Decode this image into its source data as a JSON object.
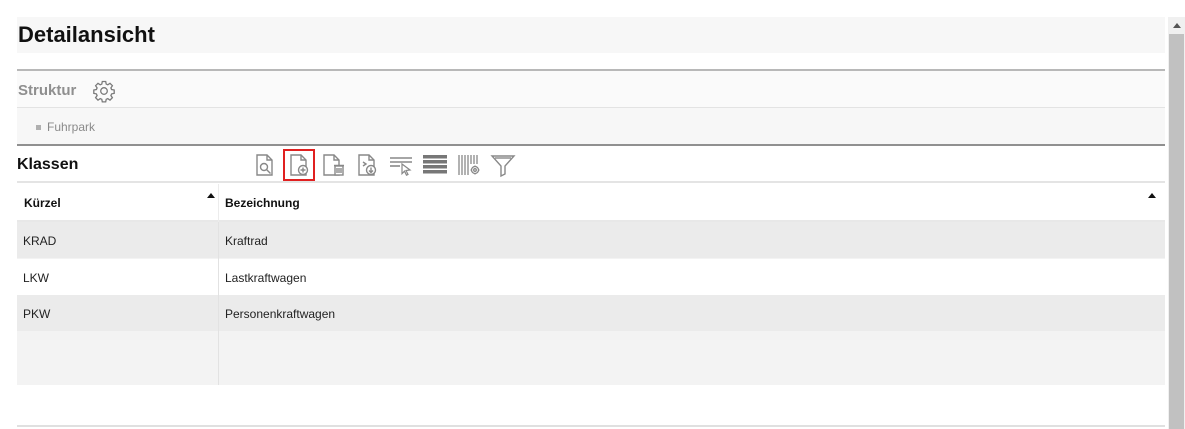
{
  "page": {
    "title": "Detailansicht"
  },
  "struktur": {
    "label": "Struktur",
    "icon": "gear-icon"
  },
  "tree": {
    "items": [
      {
        "label": "Fuhrpark"
      }
    ]
  },
  "klassen": {
    "title": "Klassen",
    "toolbar": [
      {
        "name": "view-document-icon",
        "active": false
      },
      {
        "name": "new-document-icon",
        "active": true
      },
      {
        "name": "delete-document-icon",
        "active": false
      },
      {
        "name": "export-document-icon",
        "active": false
      },
      {
        "name": "select-rows-icon",
        "active": false
      },
      {
        "name": "list-view-icon",
        "active": false
      },
      {
        "name": "column-settings-icon",
        "active": false
      },
      {
        "name": "filter-icon",
        "active": false
      }
    ]
  },
  "table": {
    "columns": [
      "Kürzel",
      "Bezeichnung"
    ],
    "rows": [
      {
        "kuerzel": "KRAD",
        "bezeichnung": "Kraftrad"
      },
      {
        "kuerzel": "LKW",
        "bezeichnung": "Lastkraftwagen"
      },
      {
        "kuerzel": "PKW",
        "bezeichnung": "Personenkraftwagen"
      }
    ]
  },
  "colors": {
    "highlight": "#e02020",
    "row_alt": "#ebebeb"
  }
}
